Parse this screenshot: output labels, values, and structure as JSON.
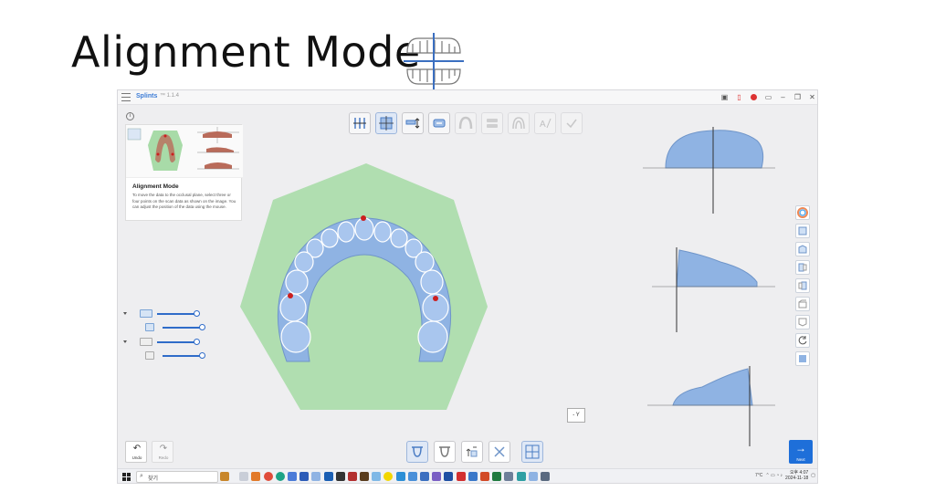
{
  "slide": {
    "title": "Alignment Mode"
  },
  "app": {
    "name": "Splints",
    "version": "™ 1.1.4",
    "info_glyph": "i"
  },
  "guide_panel": {
    "title": "Alignment Mode",
    "text": "To move the data to the occlusal plane, select three or four points on the scan data as shown on the image. You can adjust the position of the data using the mouse."
  },
  "toolbar": {
    "items": [
      {
        "icon": "axis-align-icon",
        "state": "normal"
      },
      {
        "icon": "occlusal-plane-icon",
        "state": "active"
      },
      {
        "icon": "model-move-icon",
        "state": "normal"
      },
      {
        "icon": "splint-design-icon",
        "state": "normal"
      },
      {
        "icon": "arch-icon",
        "state": "disabled"
      },
      {
        "icon": "double-layer-icon",
        "state": "disabled"
      },
      {
        "icon": "arch-outline-icon",
        "state": "disabled"
      },
      {
        "icon": "text-icon",
        "state": "disabled"
      },
      {
        "icon": "check-icon",
        "state": "disabled"
      }
    ]
  },
  "axis_label": "- Y",
  "undo": {
    "label": "Undo",
    "glyph": "↶"
  },
  "redo": {
    "label": "Redo",
    "glyph": "↷"
  },
  "next": {
    "label": "Next",
    "glyph": "→"
  },
  "taskbar": {
    "search_glyph": "⌕",
    "search_text": "찾기",
    "tray_temp": "7°C",
    "time": "오후 4:07",
    "date": "2024-11-18"
  },
  "colors": {
    "accent": "#1e6fd9",
    "model": "#8fb3e3",
    "plane": "#a8dba8",
    "point": "#cc1f1f"
  }
}
